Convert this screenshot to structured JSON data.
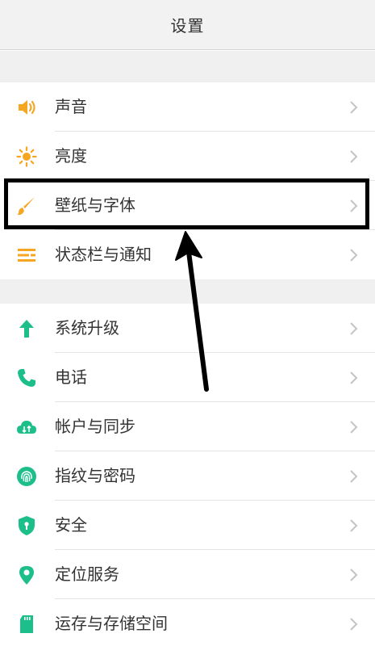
{
  "header": {
    "title": "设置"
  },
  "colors": {
    "orange": "#f5a623",
    "teal": "#1cbf8a",
    "chevron": "#c4c4c4",
    "annotation": "#000000"
  },
  "groups": [
    {
      "items": [
        {
          "label": "声音",
          "icon": "speaker-icon"
        },
        {
          "label": "亮度",
          "icon": "sun-icon"
        },
        {
          "label": "壁纸与字体",
          "icon": "brush-icon"
        },
        {
          "label": "状态栏与通知",
          "icon": "list-icon"
        }
      ]
    },
    {
      "items": [
        {
          "label": "系统升级",
          "icon": "arrow-up-icon"
        },
        {
          "label": "电话",
          "icon": "phone-icon"
        },
        {
          "label": "帐户与同步",
          "icon": "cloud-sync-icon"
        },
        {
          "label": "指纹与密码",
          "icon": "fingerprint-icon"
        },
        {
          "label": "安全",
          "icon": "shield-icon"
        },
        {
          "label": "定位服务",
          "icon": "location-pin-icon"
        },
        {
          "label": "运存与存储空间",
          "icon": "sd-card-icon"
        }
      ]
    }
  ]
}
